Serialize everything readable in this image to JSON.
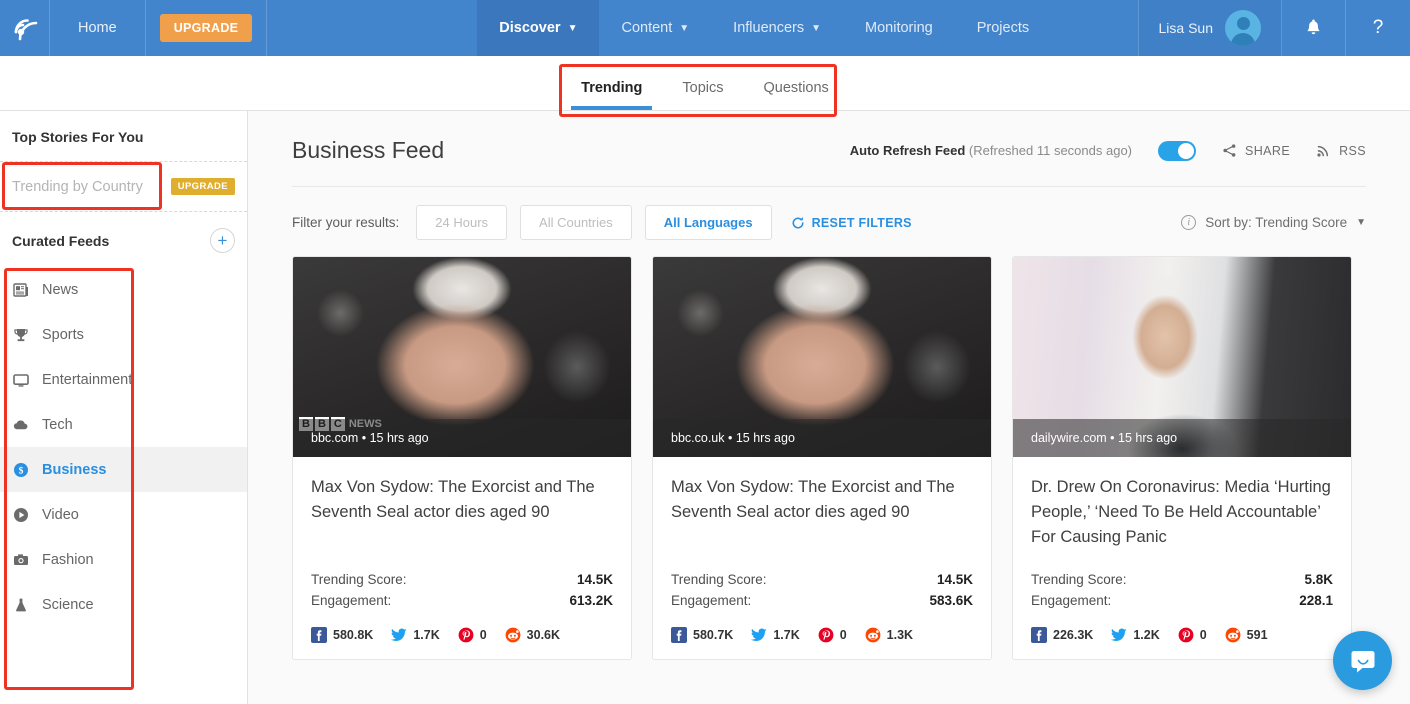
{
  "topnav": {
    "logo_icon": "rss-broadcast-logo-icon",
    "home_label": "Home",
    "upgrade_label": "UPGRADE",
    "items": [
      {
        "label": "Discover",
        "has_caret": true,
        "active": true
      },
      {
        "label": "Content",
        "has_caret": true,
        "active": false
      },
      {
        "label": "Influencers",
        "has_caret": true,
        "active": false
      },
      {
        "label": "Monitoring",
        "has_caret": false,
        "active": false
      },
      {
        "label": "Projects",
        "has_caret": false,
        "active": false
      }
    ],
    "user_name": "Lisa Sun",
    "bell_icon": "bell-icon",
    "help_label": "?",
    "bg_color": "#4285cd",
    "active_bg_color": "#3a77bd",
    "upgrade_color": "#f0a04b"
  },
  "subtabs": {
    "items": [
      {
        "label": "Trending",
        "active": true
      },
      {
        "label": "Topics",
        "active": false
      },
      {
        "label": "Questions",
        "active": false
      }
    ],
    "underline_color": "#3a8fd6",
    "annotation_color": "#ee3322"
  },
  "sidebar": {
    "top_stories_title": "Top Stories For You",
    "country_placeholder": "Trending by Country",
    "country_badge": "UPGRADE",
    "curated_title": "Curated Feeds",
    "add_icon": "plus-icon",
    "items": [
      {
        "label": "News",
        "icon": "newspaper-icon",
        "active": false
      },
      {
        "label": "Sports",
        "icon": "trophy-icon",
        "active": false
      },
      {
        "label": "Entertainment",
        "icon": "tv-icon",
        "active": false
      },
      {
        "label": "Tech",
        "icon": "cloud-icon",
        "active": false
      },
      {
        "label": "Business",
        "icon": "dollar-circle-icon",
        "active": true
      },
      {
        "label": "Video",
        "icon": "play-circle-icon",
        "active": false
      },
      {
        "label": "Fashion",
        "icon": "camera-icon",
        "active": false
      },
      {
        "label": "Science",
        "icon": "flask-icon",
        "active": false
      }
    ],
    "active_color": "#2b8fe0"
  },
  "main": {
    "feed_title": "Business Feed",
    "auto_refresh_label": "Auto Refresh Feed",
    "auto_refresh_status": " (Refreshed 11 seconds ago)",
    "auto_refresh_on": true,
    "share_label": "SHARE",
    "share_icon": "share-icon",
    "rss_label": "RSS",
    "rss_icon": "rss-icon",
    "filter_label": "Filter your results:",
    "filters": [
      {
        "label": "24 Hours",
        "active": false
      },
      {
        "label": "All Countries",
        "active": false
      },
      {
        "label": "All Languages",
        "active": true
      }
    ],
    "reset_label": "RESET FILTERS",
    "reset_icon": "refresh-icon",
    "sort_label": "Sort by: Trending Score",
    "sort_info_icon": "info-icon",
    "sort_caret_icon": "chevron-down-icon"
  },
  "cards": [
    {
      "source": "bbc.com • 15 hrs ago",
      "watermark": "BBC NEWS",
      "title": "Max Von Sydow: The Exorcist and The Seventh Seal actor dies aged 90",
      "trending_label": "Trending Score:",
      "trending_value": "14.5K",
      "engagement_label": "Engagement:",
      "engagement_value": "613.2K",
      "social": [
        {
          "network": "facebook",
          "value": "580.8K"
        },
        {
          "network": "twitter",
          "value": "1.7K"
        },
        {
          "network": "pinterest",
          "value": "0"
        },
        {
          "network": "reddit",
          "value": "30.6K"
        }
      ]
    },
    {
      "source": "bbc.co.uk • 15 hrs ago",
      "watermark": "",
      "title": "Max Von Sydow: The Exorcist and The Seventh Seal actor dies aged 90",
      "trending_label": "Trending Score:",
      "trending_value": "14.5K",
      "engagement_label": "Engagement:",
      "engagement_value": "583.6K",
      "social": [
        {
          "network": "facebook",
          "value": "580.7K"
        },
        {
          "network": "twitter",
          "value": "1.7K"
        },
        {
          "network": "pinterest",
          "value": "0"
        },
        {
          "network": "reddit",
          "value": "1.3K"
        }
      ]
    },
    {
      "source": "dailywire.com • 15 hrs ago",
      "watermark": "",
      "title": "Dr. Drew On Coronavirus: Media ‘Hurting People,’ ‘Need To Be Held Accountable’ For Causing Panic",
      "trending_label": "Trending Score:",
      "trending_value": "5.8K",
      "engagement_label": "Engagement:",
      "engagement_value": "228.1",
      "social": [
        {
          "network": "facebook",
          "value": "226.3K"
        },
        {
          "network": "twitter",
          "value": "1.2K"
        },
        {
          "network": "pinterest",
          "value": "0"
        },
        {
          "network": "reddit",
          "value": "591"
        }
      ]
    }
  ],
  "chat": {
    "icon": "chat-bubble-icon",
    "color": "#2b9be0"
  }
}
